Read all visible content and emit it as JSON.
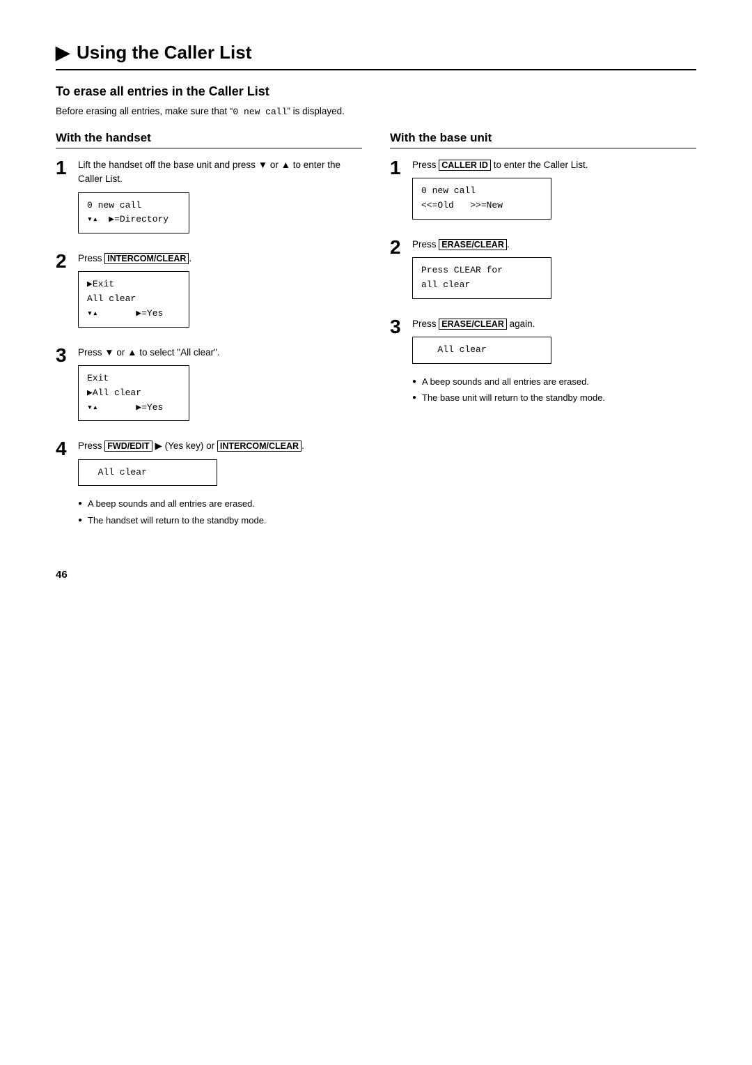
{
  "page": {
    "title": "Using the Caller List",
    "arrow_icon": "▶",
    "page_number": "46"
  },
  "section": {
    "title": "To erase all entries in the Caller List",
    "intro": "Before erasing all entries, make sure that “",
    "intro_code": "0 new call",
    "intro_end": "” is displayed."
  },
  "handset_column": {
    "title": "With the handset",
    "steps": [
      {
        "number": "1",
        "text_parts": [
          "Lift the handset off the base unit and press ",
          " or ",
          " to enter the Caller List."
        ],
        "lcd_lines": [
          "0 new call",
          "▾▴  ▶=Directory"
        ]
      },
      {
        "number": "2",
        "text_before": "Press ",
        "button": "INTERCOM/CLEAR",
        "text_after": ".",
        "lcd_lines": [
          "▶Exit",
          "All clear",
          "▾▴       ▶=Yes"
        ]
      },
      {
        "number": "3",
        "text_before": "Press ",
        "button_down": "▼",
        "text_mid": " or ",
        "button_up": "▲",
        "text_after": " to select “All clear”.",
        "lcd_lines": [
          "Exit",
          "▶All clear",
          "▾▴       ▶=Yes"
        ]
      },
      {
        "number": "4",
        "text_before": "Press ",
        "button1": "FWD/EDIT",
        "text_mid": " ▶ (Yes key) or ",
        "button2": "INTERCOM/CLEAR",
        "text_after": ".",
        "lcd_lines": [
          "All clear"
        ],
        "bullets": [
          "A beep sounds and all entries are erased.",
          "The handset will return to the standby mode."
        ]
      }
    ]
  },
  "base_column": {
    "title": "With the base unit",
    "steps": [
      {
        "number": "1",
        "text_before": "Press ",
        "button": "CALLER ID",
        "text_after": " to enter the Caller List.",
        "lcd_lines": [
          "0 new call",
          "<=Old    >>=New"
        ]
      },
      {
        "number": "2",
        "text_before": "Press ",
        "button": "ERASE/CLEAR",
        "text_after": ".",
        "lcd_lines": [
          "Press CLEAR for",
          "all clear"
        ]
      },
      {
        "number": "3",
        "text_before": "Press ",
        "button": "ERASE/CLEAR",
        "text_after": " again.",
        "lcd_lines": [
          "All clear"
        ],
        "bullets": [
          "A beep sounds and all entries are erased.",
          "The base unit will return to the standby mode."
        ]
      }
    ]
  }
}
